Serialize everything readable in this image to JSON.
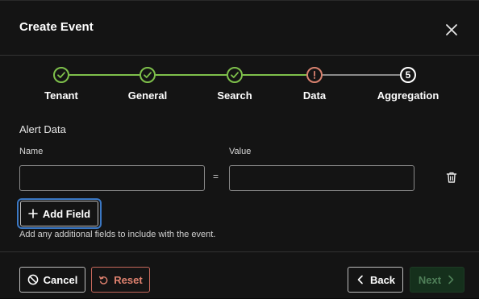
{
  "dialog": {
    "title": "Create Event",
    "close_icon": "close-icon"
  },
  "stepper": {
    "steps": [
      {
        "label": "Tenant",
        "status": "complete",
        "icon": "check-icon"
      },
      {
        "label": "General",
        "status": "complete",
        "icon": "check-icon"
      },
      {
        "label": "Search",
        "status": "complete",
        "icon": "check-icon"
      },
      {
        "label": "Data",
        "status": "error",
        "icon": "exclamation-icon"
      },
      {
        "label": "Aggregation",
        "status": "upcoming",
        "number": "5"
      }
    ]
  },
  "form": {
    "section_title": "Alert Data",
    "name_label": "Name",
    "value_label": "Value",
    "name_value": "",
    "value_value": "",
    "separator": "=",
    "add_field_label": "Add Field",
    "helper_text": "Add any additional fields to include with the event."
  },
  "footer": {
    "cancel_label": "Cancel",
    "reset_label": "Reset",
    "back_label": "Back",
    "next_label": "Next"
  },
  "colors": {
    "complete": "#7ec04b",
    "error": "#d9826f",
    "upcoming": "#ffffff",
    "focus_ring": "#3b78c4"
  }
}
